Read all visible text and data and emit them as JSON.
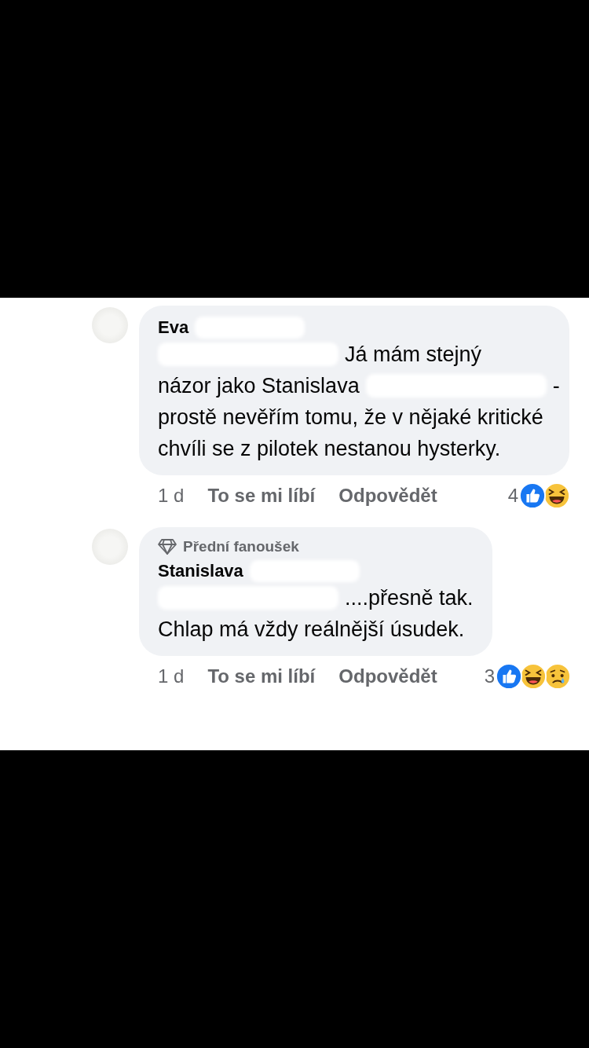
{
  "comments": [
    {
      "author": "Eva",
      "author_redacted": true,
      "lines": [
        [
          {
            "kind": "redaction"
          },
          {
            "kind": "text",
            "text": "Já mám stejný"
          }
        ],
        [
          {
            "kind": "text",
            "text": "názor jako Stanislava"
          },
          {
            "kind": "redaction"
          },
          {
            "kind": "text",
            "text": "-"
          }
        ],
        [
          {
            "kind": "text",
            "text": "prostě nevěřím tomu, že v nějaké kritické chvíli se z pilotek nestanou hysterky."
          }
        ]
      ],
      "time": "1 d",
      "like": "To se mi líbí",
      "reply": "Odpovědět",
      "reaction_count": "4",
      "reactions": [
        {
          "kind": "like"
        },
        {
          "kind": "haha"
        }
      ]
    },
    {
      "badge": "Přední fanoušek",
      "author": "Stanislava",
      "author_redacted": true,
      "lines": [
        [
          {
            "kind": "redaction"
          },
          {
            "kind": "text",
            "text": "....přesně tak."
          }
        ],
        [
          {
            "kind": "text",
            "text": "Chlap má vždy reálnější úsudek."
          }
        ]
      ],
      "time": "1 d",
      "like": "To se mi líbí",
      "reply": "Odpovědět",
      "reaction_count": "3",
      "reactions": [
        {
          "kind": "like"
        },
        {
          "kind": "haha"
        },
        {
          "kind": "sad"
        }
      ]
    }
  ]
}
